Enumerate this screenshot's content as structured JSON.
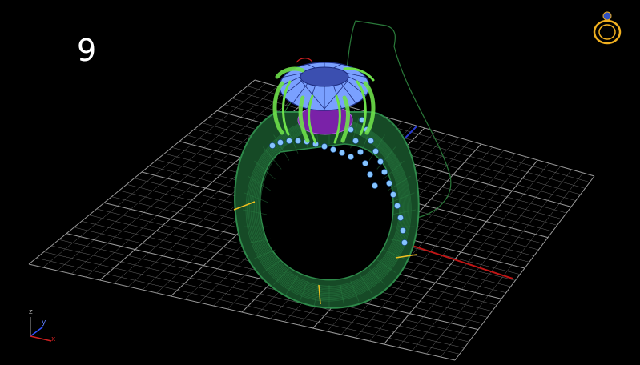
{
  "overlay": {
    "step_number": "9"
  },
  "gizmo": {
    "x_label": "x",
    "y_label": "y",
    "z_label": "z"
  },
  "icons": {
    "view_cube": "ring-icon",
    "axes": "axis-gizmo-icon"
  },
  "colors": {
    "background": "#000000",
    "grid": "#9a9a9a",
    "ring_wire": "#2e8a4a",
    "ring_fill": "#164a26",
    "prong": "#6ee04a",
    "gem": "#7aa0ff",
    "gem_dark": "#3b4fb0",
    "gallery": "#7a22a8",
    "pave": "#86c4ff",
    "x_axis": "#c01616",
    "y_axis": "#2a3ccf",
    "marker": "#f0c020",
    "nav_ring": "#f0b020"
  }
}
